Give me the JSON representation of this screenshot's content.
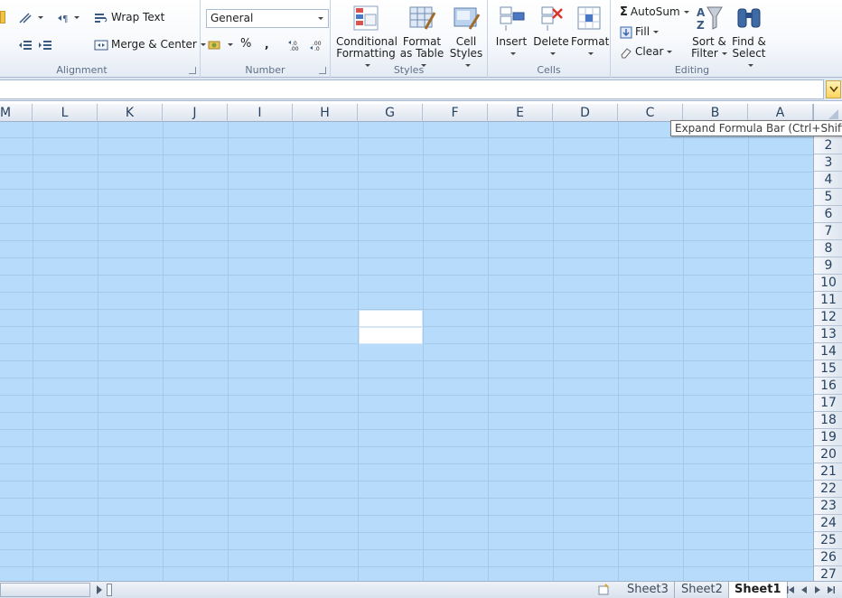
{
  "ribbon": {
    "alignment": {
      "label": "Alignment",
      "wrap_text": "Wrap Text",
      "merge_center": "Merge & Center"
    },
    "number": {
      "label": "Number",
      "format_value": "General",
      "percent": "%",
      "comma": ","
    },
    "styles": {
      "label": "Styles",
      "conditional_formatting_l1": "Conditional",
      "conditional_formatting_l2": "Formatting",
      "format_table_l1": "Format",
      "format_table_l2": "as Table",
      "cell_styles_l1": "Cell",
      "cell_styles_l2": "Styles"
    },
    "cells": {
      "label": "Cells",
      "insert": "Insert",
      "delete": "Delete",
      "format": "Format"
    },
    "editing": {
      "label": "Editing",
      "autosum": "AutoSum",
      "fill": "Fill",
      "clear": "Clear",
      "sort_filter_l1": "Sort &",
      "sort_filter_l2": "Filter",
      "find_select_l1": "Find &",
      "find_select_l2": "Select"
    }
  },
  "formula_bar": {
    "value": "",
    "expand_tooltip": "Expand Formula Bar (Ctrl+Shift+U)"
  },
  "grid": {
    "columns": [
      "M",
      "L",
      "K",
      "J",
      "I",
      "H",
      "G",
      "F",
      "E",
      "D",
      "C",
      "B",
      "A"
    ],
    "rows": [
      "2",
      "3",
      "4",
      "5",
      "6",
      "7",
      "8",
      "9",
      "10",
      "11",
      "12",
      "13",
      "14",
      "15",
      "16",
      "17",
      "18",
      "19",
      "20",
      "21",
      "22",
      "23",
      "24",
      "25",
      "26",
      "27"
    ]
  },
  "sheets": {
    "tabs": [
      "Sheet3",
      "Sheet2",
      "Sheet1"
    ],
    "active": "Sheet1"
  },
  "colors": {
    "selection": "#b7dbfa",
    "header": "#dde5ef",
    "ribbon_text": "#1e395b"
  }
}
